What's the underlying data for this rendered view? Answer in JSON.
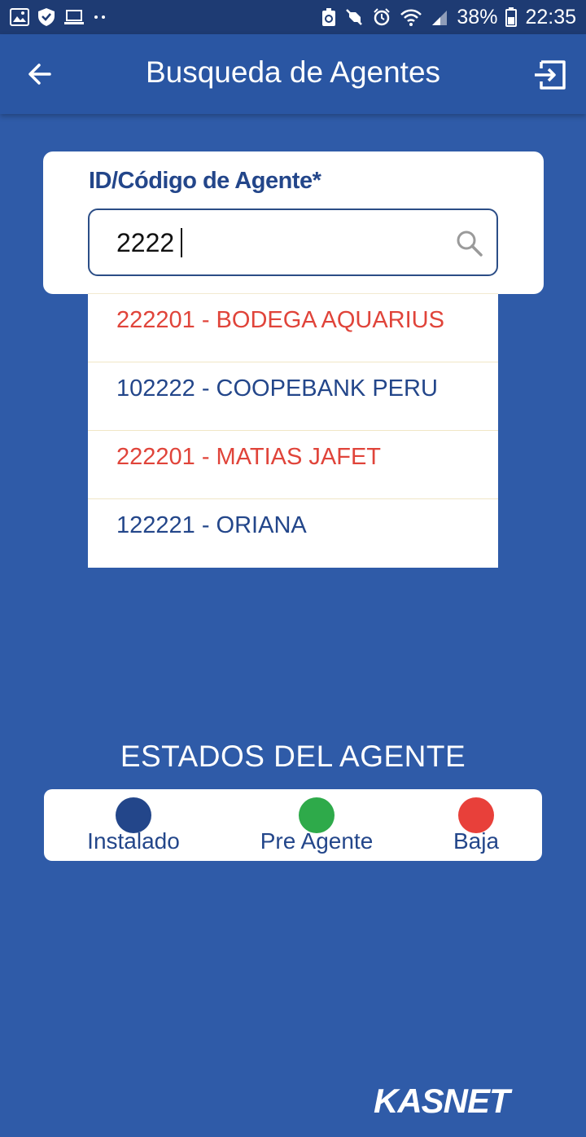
{
  "status_bar": {
    "battery": "38%",
    "time": "22:35",
    "left_icons": [
      "image-icon",
      "shield-icon",
      "laptop-icon",
      "dots-icon"
    ],
    "right_icons": [
      "recycle-icon",
      "mute-icon",
      "alarm-icon",
      "wifi-icon",
      "signal-icon",
      "battery-icon"
    ]
  },
  "app_bar": {
    "title": "Busqueda de Agentes",
    "back_icon": "arrow-left-icon",
    "logout_icon": "logout-icon"
  },
  "search": {
    "label": "ID/Código de Agente*",
    "value": "2222",
    "icon": "search-icon"
  },
  "results": [
    {
      "text": "222201 - BODEGA AQUARIUS",
      "color": "#e0443a"
    },
    {
      "text": "102222 - COOPEBANK PERU",
      "color": "#23468a"
    },
    {
      "text": "222201 - MATIAS JAFET",
      "color": "#e0443a"
    },
    {
      "text": "122221 - ORIANA",
      "color": "#23468a"
    }
  ],
  "estados": {
    "title": "ESTADOS DEL AGENTE",
    "items": [
      {
        "label": "Instalado",
        "color": "#23468a"
      },
      {
        "label": "Pre Agente",
        "color": "#2eaa4a"
      },
      {
        "label": "Baja",
        "color": "#e8403a"
      }
    ]
  },
  "brand": {
    "name": "KASNET"
  }
}
